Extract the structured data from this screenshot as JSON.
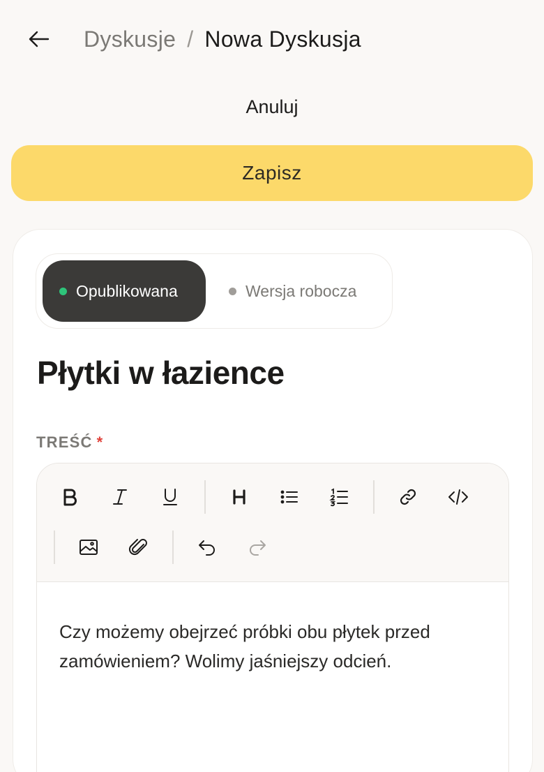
{
  "header": {
    "back_icon": "arrow-left-icon",
    "breadcrumb_parent": "Dyskusje",
    "breadcrumb_separator": "/",
    "breadcrumb_current": "Nowa Dyskusja"
  },
  "actions": {
    "cancel_label": "Anuluj",
    "save_label": "Zapisz"
  },
  "status_toggle": {
    "selected": "Opublikowana",
    "options": [
      {
        "label": "Opublikowana",
        "dot_color": "#2ec47a"
      },
      {
        "label": "Wersja robocza",
        "dot_color": "#a09d99"
      }
    ]
  },
  "title": "Płytki w łazience",
  "content_field": {
    "label": "TREŚĆ",
    "required_marker": "*",
    "toolbar": [
      "bold-icon",
      "italic-icon",
      "underline-icon",
      "heading-icon",
      "bullet-list-icon",
      "numbered-list-icon",
      "link-icon",
      "code-icon",
      "image-icon",
      "attachment-icon",
      "undo-icon",
      "redo-icon"
    ],
    "body": "Czy możemy obejrzeć próbki obu płytek przed zamówieniem? Wolimy jaśniejszy odcień."
  },
  "colors": {
    "accent": "#fcd96a",
    "active_segment": "#3b3a38",
    "background": "#faf8f6",
    "required": "#e0413a"
  }
}
